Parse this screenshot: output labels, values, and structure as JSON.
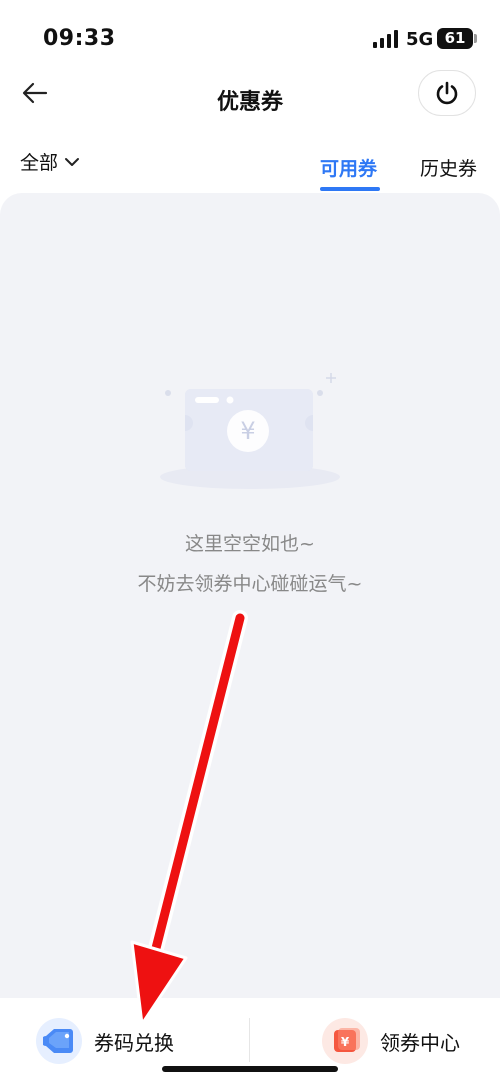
{
  "status_bar": {
    "time": "09:33",
    "network": "5G",
    "battery": "61"
  },
  "header": {
    "title": "优惠券"
  },
  "filter": {
    "dropdown_label": "全部"
  },
  "tabs": [
    {
      "label": "可用券",
      "active": true
    },
    {
      "label": "历史券",
      "active": false
    }
  ],
  "empty_state": {
    "title": "这里空空如也~",
    "subtitle": "不妨去领券中心碰碰运气~"
  },
  "bottom_bar": {
    "exchange_label": "券码兑换",
    "center_label": "领券中心"
  },
  "colors": {
    "accent": "#2e78f5",
    "panel_bg": "#f2f3f7",
    "annotation_arrow": "#ee1111"
  }
}
